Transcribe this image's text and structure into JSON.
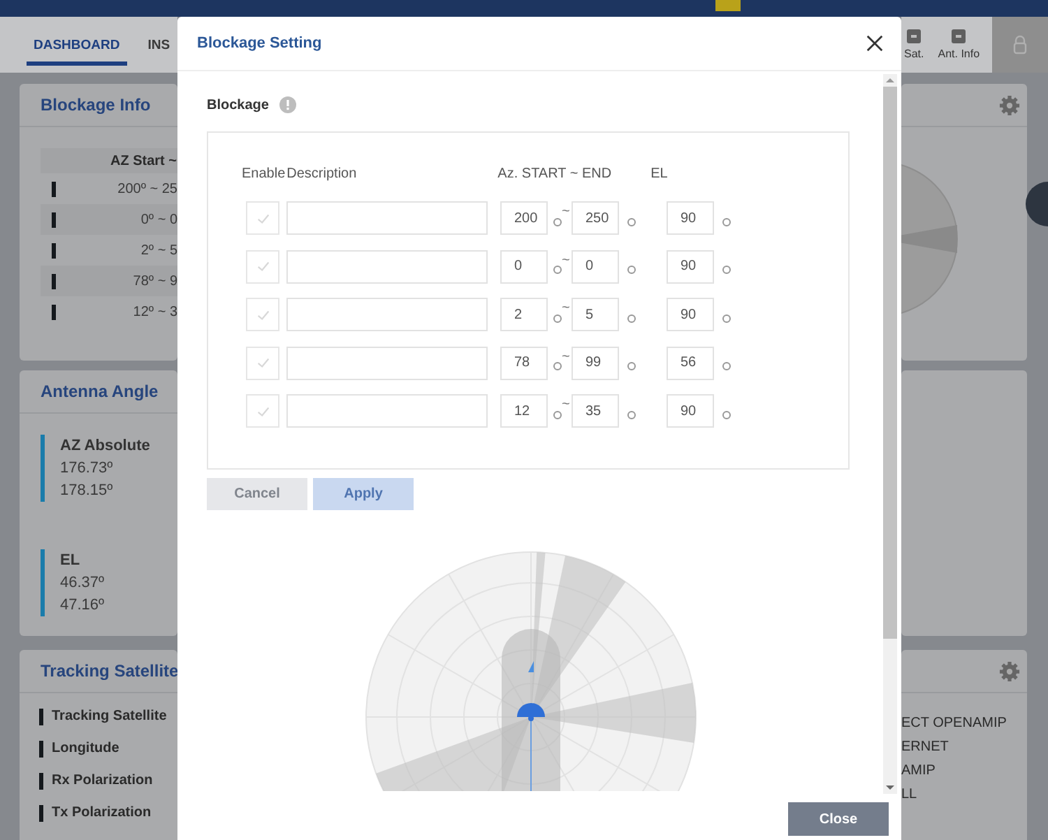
{
  "tabs": [
    {
      "label": "DASHBOARD",
      "selected": true
    },
    {
      "label": "INS",
      "selected": false
    }
  ],
  "toolbar": [
    {
      "label": "Sat."
    },
    {
      "label": "Ant. Info"
    }
  ],
  "blockage_info": {
    "title": "Blockage Info",
    "column": "AZ Start ~",
    "rows": [
      "200º ~ 25",
      "0º ~ 0",
      "2º ~ 5",
      "78º ~ 9",
      "12º ~ 3"
    ]
  },
  "antenna_angle": {
    "title": "Antenna Angle",
    "groups": [
      {
        "label": "AZ Absolute",
        "values": [
          "176.73º",
          "178.15º"
        ]
      },
      {
        "label": "EL",
        "values": [
          "46.37º",
          "47.16º"
        ]
      }
    ]
  },
  "tracking_satellite": {
    "title": "Tracking Satellite",
    "items": [
      "Tracking Satellite",
      "Longitude",
      "Rx Polarization",
      "Tx Polarization"
    ]
  },
  "right_panel_items": [
    "ECT OPENAMIP",
    "ERNET",
    "AMIP",
    "LL"
  ],
  "dialog": {
    "title": "Blockage Setting",
    "section": "Blockage",
    "columns": [
      "Enable",
      "Description",
      "Az. START ~ END",
      "EL"
    ],
    "rows": [
      {
        "checked": false,
        "az_start": "200",
        "separator": "~",
        "az_end": "250",
        "el": "90"
      },
      {
        "checked": false,
        "az_start": "0",
        "separator": "~",
        "az_end": "0",
        "el": "90"
      },
      {
        "checked": false,
        "az_start": "2",
        "separator": "~",
        "az_end": "5",
        "el": "90"
      },
      {
        "checked": false,
        "az_start": "78",
        "separator": "~",
        "az_end": "99",
        "el": "56"
      },
      {
        "checked": false,
        "az_start": "12",
        "separator": "~",
        "az_end": "35",
        "el": "90"
      }
    ],
    "buttons": [
      {
        "label": "Cancel",
        "disabled": true
      },
      {
        "label": "Apply",
        "disabled": true
      }
    ],
    "close_button": "Close"
  }
}
